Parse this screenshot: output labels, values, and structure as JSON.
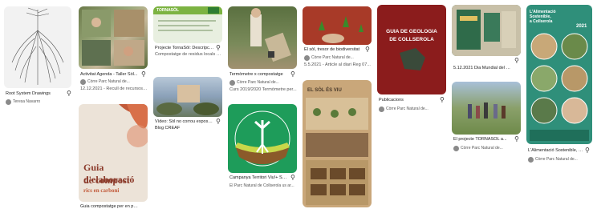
{
  "pins": {
    "root_system": {
      "title": "Root System Drawings",
      "author": "Teresa Navarro",
      "thumb_color": "#f2f2f2"
    },
    "activitat": {
      "title": "Activitat Agenda - Taller Sòl...",
      "author": "Còrre Parc Natural de...",
      "subtitle": "12.12.2021 - Recull de recursos de...",
      "thumb_color": "#7a8a5a"
    },
    "guia_compost": {
      "title": "Guia compostatge per en paral...",
      "overlay_1": "Guia d'elaboració",
      "overlay_2": "de compost",
      "overlay_3": "rics en carboni",
      "thumb_color": "#ece3d8"
    },
    "projecte_tornasol": {
      "title": "Projecte TornaSòl: Descripció...",
      "subtitle": "Compostatge de residus locals en...",
      "header_text": "TORNASÒL",
      "thumb_color": "#e8efe0"
    },
    "video_sol": {
      "title": "Vídeo: Sòl no corrou exposat -",
      "subtitle": "Blog CREAF",
      "thumb_color": "#9ab0c8"
    },
    "termometre": {
      "title": "Termòmetre x compostatge",
      "author": "Còrre Parc Natural de...",
      "subtitle": "Curs 2019/2020 Termòmetre per...",
      "thumb_color": "#6b7a55"
    },
    "campanya": {
      "title": "Campanya Territori Viu!+ Sòl...",
      "author": "El Parc Natural de Collserola us ar...",
      "thumb_color": "#1e9c5a"
    },
    "sol_tresor": {
      "title": "El sòl, tresor de biodiversitat",
      "author": "Còrre Parc Natural de...",
      "subtitle": "5.5.2021 - Article al diari Reg 07...",
      "thumb_color": "#b23a2a"
    },
    "infografia": {
      "title": "",
      "header": "EL SÒL ÉS VIU",
      "thumb_color": "#c9a77a"
    },
    "guia_geologia": {
      "title": "Publicacions",
      "author": "Còrre Parc Natural de...",
      "book_title_1": "GUIA DE GEOLOGIA",
      "book_title_2": "DE COLLSEROLA",
      "thumb_color": "#8b1c1c"
    },
    "dia_mundial": {
      "title": "5.12.2021 Dia Mundial del Sòl...",
      "thumb_color": "#3a6b4a"
    },
    "projecte_tornasol_2": {
      "title": "El projecte TORNASÒL a...",
      "author": "Còrre Parc Natural de...",
      "thumb_color": "#6e8a4a"
    },
    "alimentacio": {
      "title": "L'Alimentació Sostenible, a...",
      "author": "Còrre Parc Natural de...",
      "header_1": "L'Alimentació",
      "header_2": "Sostenible,",
      "header_3": "a Collserola",
      "year": "2021",
      "thumb_color": "#2f8f7a"
    }
  },
  "pin_icon": "pushpin-icon",
  "colors": {
    "brand_green": "#1e9c5a",
    "dark_red": "#8b1c1c",
    "teal": "#2f8f7a"
  }
}
